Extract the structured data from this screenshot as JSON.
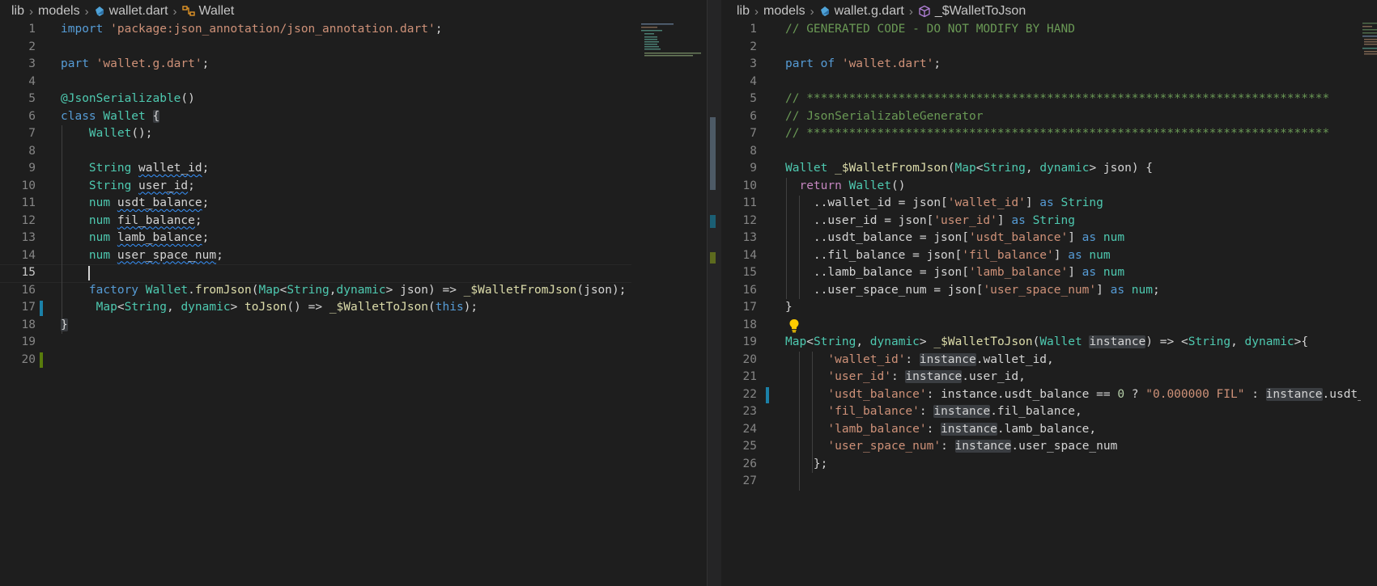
{
  "colors": {
    "background": "#1e1e1e",
    "keyword": "#569cd6",
    "string": "#ce9178",
    "type": "#4ec9b0",
    "function": "#dcdcaa",
    "comment": "#6a9955",
    "gutter_modified": "#1b81a8",
    "gutter_added": "#587c0c"
  },
  "left": {
    "breadcrumb": {
      "folder1": "lib",
      "folder2": "models",
      "file": "wallet.dart",
      "symbol": "Wallet"
    },
    "line_numbers": [
      "1",
      "2",
      "3",
      "4",
      "5",
      "6",
      "7",
      "8",
      "9",
      "10",
      "11",
      "12",
      "13",
      "14",
      "15",
      "16",
      "17",
      "18",
      "19",
      "20"
    ],
    "code": {
      "l1_import": "import",
      "l1_str": "'package:json_annotation/json_annotation.dart'",
      "l1_semi": ";",
      "l3_part": "part",
      "l3_str": "'wallet.g.dart'",
      "l3_semi": ";",
      "l5_ann": "@JsonSerializable",
      "l5_rest": "()",
      "l6_class": "class",
      "l6_name": "Wallet",
      "l6_brace": "{",
      "l7_ctor": "Wallet",
      "l7_rest": "();",
      "l9_type": "String",
      "l9_field": "wallet_id",
      "l9_semi": ";",
      "l10_type": "String",
      "l10_field": "user_id",
      "l10_semi": ";",
      "l11_type": "num",
      "l11_field": "usdt_balance",
      "l11_semi": ";",
      "l12_type": "num",
      "l12_field": "fil_balance",
      "l12_semi": ";",
      "l13_type": "num",
      "l13_field": "lamb_balance",
      "l13_semi": ";",
      "l14_type": "num",
      "l14_field": "user_space_num",
      "l14_semi": ";",
      "l16_factory": "factory",
      "l16_cls": "Wallet",
      "l16_dot": ".",
      "l16_fn": "fromJson",
      "l16_p1": "(",
      "l16_map": "Map",
      "l16_lt": "<",
      "l16_str": "String",
      "l16_comma": ",",
      "l16_dyn": "dynamic",
      "l16_gt": "> json) => ",
      "l16_call": "_$WalletFromJson",
      "l16_end": "(json);",
      "l17_map": "Map",
      "l17_lt": "<",
      "l17_str": "String",
      "l17_comma": ", ",
      "l17_dyn": "dynamic",
      "l17_gt": "> ",
      "l17_fn": "toJson",
      "l17_mid": "() => ",
      "l17_call": "_$WalletToJson",
      "l17_p": "(",
      "l17_this": "this",
      "l17_end": ");",
      "l18_brace": "}"
    }
  },
  "right": {
    "breadcrumb": {
      "folder1": "lib",
      "folder2": "models",
      "file": "wallet.g.dart",
      "symbol": "_$WalletToJson"
    },
    "line_numbers": [
      "1",
      "2",
      "3",
      "4",
      "5",
      "6",
      "7",
      "8",
      "9",
      "10",
      "11",
      "12",
      "13",
      "14",
      "15",
      "16",
      "17",
      "18",
      "19",
      "20",
      "21",
      "22",
      "23",
      "24",
      "25",
      "26",
      "27"
    ],
    "code": {
      "l1": "// GENERATED CODE - DO NOT MODIFY BY HAND",
      "l3_part": "part of",
      "l3_str": "'wallet.dart'",
      "l3_semi": ";",
      "l5": "// **************************************************************************",
      "l6": "// JsonSerializableGenerator",
      "l7": "// **************************************************************************",
      "l9_type": "Wallet",
      "l9_fn": "_$WalletFromJson",
      "l9_p": "(",
      "l9_map": "Map",
      "l9_lt": "<",
      "l9_str": "String",
      "l9_c": ", ",
      "l9_dyn": "dynamic",
      "l9_end": "> json) {",
      "l10_ret": "return",
      "l10_cls": "Wallet",
      "l10_end": "()",
      "l11_a": "..wallet_id = json[",
      "l11_s": "'wallet_id'",
      "l11_b": "] ",
      "l11_as": "as",
      "l11_t": "String",
      "l12_a": "..user_id = json[",
      "l12_s": "'user_id'",
      "l12_b": "] ",
      "l12_as": "as",
      "l12_t": "String",
      "l13_a": "..usdt_balance = json[",
      "l13_s": "'usdt_balance'",
      "l13_b": "] ",
      "l13_as": "as",
      "l13_t": "num",
      "l14_a": "..fil_balance = json[",
      "l14_s": "'fil_balance'",
      "l14_b": "] ",
      "l14_as": "as",
      "l14_t": "num",
      "l15_a": "..lamb_balance = json[",
      "l15_s": "'lamb_balance'",
      "l15_b": "] ",
      "l15_as": "as",
      "l15_t": "num",
      "l16_a": "..user_space_num = json[",
      "l16_s": "'user_space_num'",
      "l16_b": "] ",
      "l16_as": "as",
      "l16_t": "num",
      "l16_semi": ";",
      "l17": "}",
      "l19_map": "Map",
      "l19_lt": "<",
      "l19_str": "String",
      "l19_c": ", ",
      "l19_dyn": "dynamic",
      "l19_gt": "> ",
      "l19_fn": "_$WalletToJson",
      "l19_p": "(",
      "l19_cls": "Wallet",
      "l19_sp": " ",
      "l19_inst": "instance",
      "l19_arrow": ") => <",
      "l19_str2": "String",
      "l19_c2": ", ",
      "l19_dyn2": "dynamic",
      "l19_end": ">{",
      "l20_s": "'wallet_id'",
      "l20_a": ": ",
      "l20_i": "instance",
      "l20_b": ".wallet_id,",
      "l21_s": "'user_id'",
      "l21_a": ": ",
      "l21_i": "instance",
      "l21_b": ".user_id,",
      "l22_s": "'usdt_balance'",
      "l22_a": ": instance.usdt_balance == ",
      "l22_n": "0",
      "l22_q": " ? ",
      "l22_s2": "\"0.000000 FIL\"",
      "l22_c": " : ",
      "l22_i": "instance",
      "l22_b": ".usdt_",
      "l23_s": "'fil_balance'",
      "l23_a": ": ",
      "l23_i": "instance",
      "l23_b": ".fil_balance,",
      "l24_s": "'lamb_balance'",
      "l24_a": ": ",
      "l24_i": "instance",
      "l24_b": ".lamb_balance,",
      "l25_s": "'user_space_num'",
      "l25_a": ": ",
      "l25_i": "instance",
      "l25_b": ".user_space_num",
      "l26": "};"
    }
  }
}
